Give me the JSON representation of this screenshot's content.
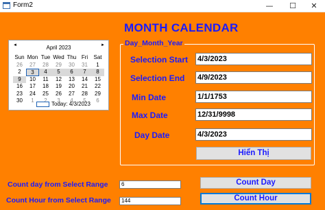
{
  "window": {
    "title": "Form2",
    "minimize": "—",
    "maximize": "☐",
    "close": "✕"
  },
  "heading": "MONTH CALENDAR",
  "calendar": {
    "month_label": "April 2023",
    "prev": "◄",
    "next": "►",
    "day_headers": [
      "Sun",
      "Mon",
      "Tue",
      "Wed",
      "Thu",
      "Fri",
      "Sat"
    ],
    "weeks": [
      [
        "26",
        "27",
        "28",
        "29",
        "30",
        "31",
        "1"
      ],
      [
        "2",
        "3",
        "4",
        "5",
        "6",
        "7",
        "8"
      ],
      [
        "9",
        "10",
        "11",
        "12",
        "13",
        "14",
        "15"
      ],
      [
        "16",
        "17",
        "18",
        "19",
        "20",
        "21",
        "22"
      ],
      [
        "23",
        "24",
        "25",
        "26",
        "27",
        "28",
        "29"
      ],
      [
        "30",
        "1",
        "2",
        "3",
        "4",
        "5",
        "6"
      ]
    ],
    "today_label": "Today: 4/3/2023"
  },
  "group": {
    "title": "Day_Month_Year",
    "selection_start_label": "Selection Start",
    "selection_start_value": "4/3/2023",
    "selection_end_label": "Selection End",
    "selection_end_value": "4/9/2023",
    "min_date_label": "Min Date",
    "min_date_value": "1/1/1753",
    "max_date_label": "Max Date",
    "max_date_value": "12/31/9998",
    "day_date_label": "Day Date",
    "day_date_value": "4/3/2023",
    "show_button": "Hiển Thị"
  },
  "counts": {
    "count_day_label": "Count day from Select Range",
    "count_day_value": "6",
    "count_hour_label": "Count Hour from Select Range",
    "count_hour_value": "144",
    "count_day_button": "Count Day",
    "count_hour_button": "Count Hour"
  }
}
